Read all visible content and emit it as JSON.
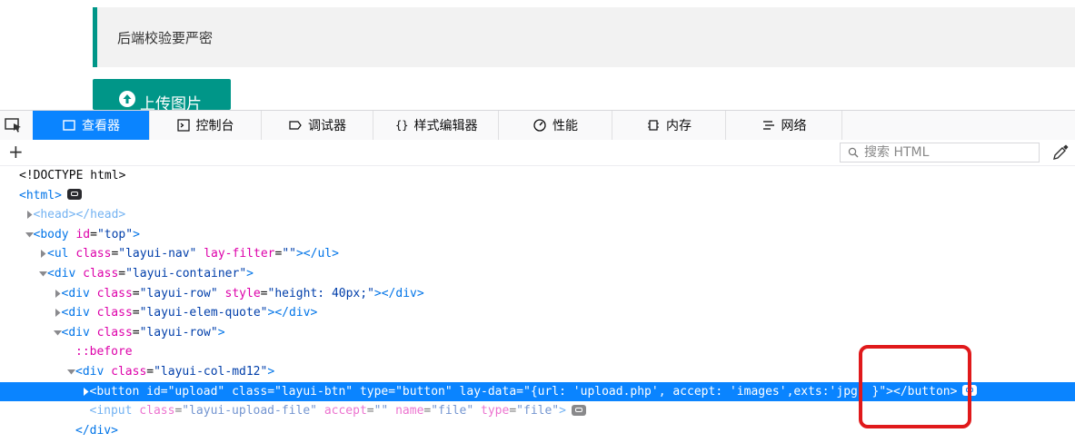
{
  "page": {
    "quote_text": "后端校验要严密",
    "upload_button_label": "上传图片"
  },
  "devtools": {
    "tabs": [
      {
        "label": "查看器",
        "icon": "inspector-icon",
        "active": true
      },
      {
        "label": "控制台",
        "icon": "console-icon",
        "active": false
      },
      {
        "label": "调试器",
        "icon": "debugger-icon",
        "active": false
      },
      {
        "label": "样式编辑器",
        "icon": "style-editor-icon",
        "active": false
      },
      {
        "label": "性能",
        "icon": "performance-icon",
        "active": false
      },
      {
        "label": "内存",
        "icon": "memory-icon",
        "active": false
      },
      {
        "label": "网络",
        "icon": "network-icon",
        "active": false
      }
    ],
    "search_placeholder": "搜索 HTML",
    "accent_color": "#0a84ff"
  },
  "tree": [
    {
      "indent": 0,
      "twisty": "none",
      "selected": false,
      "tokens": [
        [
          "txt",
          "<!DOCTYPE html>"
        ]
      ]
    },
    {
      "indent": 0,
      "twisty": "none",
      "selected": false,
      "badge": true,
      "tokens": [
        [
          "tag",
          "<html>"
        ]
      ]
    },
    {
      "indent": 1,
      "twisty": "closed",
      "selected": false,
      "dim": true,
      "tokens": [
        [
          "tag",
          "<head></head>"
        ]
      ]
    },
    {
      "indent": 1,
      "twisty": "open",
      "selected": false,
      "tokens": [
        [
          "tag",
          "<body"
        ],
        [
          "txt",
          " "
        ],
        [
          "attr",
          "id"
        ],
        [
          "txt",
          "="
        ],
        [
          "val",
          "\"top\""
        ],
        [
          "tag",
          ">"
        ]
      ]
    },
    {
      "indent": 2,
      "twisty": "closed",
      "selected": false,
      "tokens": [
        [
          "tag",
          "<ul"
        ],
        [
          "txt",
          " "
        ],
        [
          "attr",
          "class"
        ],
        [
          "txt",
          "="
        ],
        [
          "val",
          "\"layui-nav\""
        ],
        [
          "txt",
          " "
        ],
        [
          "attr",
          "lay-filter"
        ],
        [
          "txt",
          "="
        ],
        [
          "val",
          "\"\""
        ],
        [
          "tag",
          "></ul>"
        ]
      ]
    },
    {
      "indent": 2,
      "twisty": "open",
      "selected": false,
      "tokens": [
        [
          "tag",
          "<div"
        ],
        [
          "txt",
          " "
        ],
        [
          "attr",
          "class"
        ],
        [
          "txt",
          "="
        ],
        [
          "val",
          "\"layui-container\""
        ],
        [
          "tag",
          ">"
        ]
      ]
    },
    {
      "indent": 3,
      "twisty": "closed",
      "selected": false,
      "tokens": [
        [
          "tag",
          "<div"
        ],
        [
          "txt",
          " "
        ],
        [
          "attr",
          "class"
        ],
        [
          "txt",
          "="
        ],
        [
          "val",
          "\"layui-row\""
        ],
        [
          "txt",
          " "
        ],
        [
          "attr",
          "style"
        ],
        [
          "txt",
          "="
        ],
        [
          "val",
          "\"height: 40px;\""
        ],
        [
          "tag",
          "></div>"
        ]
      ]
    },
    {
      "indent": 3,
      "twisty": "closed",
      "selected": false,
      "tokens": [
        [
          "tag",
          "<div"
        ],
        [
          "txt",
          " "
        ],
        [
          "attr",
          "class"
        ],
        [
          "txt",
          "="
        ],
        [
          "val",
          "\"layui-elem-quote\""
        ],
        [
          "tag",
          "></div>"
        ]
      ]
    },
    {
      "indent": 3,
      "twisty": "open",
      "selected": false,
      "tokens": [
        [
          "tag",
          "<div"
        ],
        [
          "txt",
          " "
        ],
        [
          "attr",
          "class"
        ],
        [
          "txt",
          "="
        ],
        [
          "val",
          "\"layui-row\""
        ],
        [
          "tag",
          ">"
        ]
      ]
    },
    {
      "indent": 4,
      "twisty": "none",
      "selected": false,
      "tokens": [
        [
          "pseudo",
          "::before"
        ]
      ]
    },
    {
      "indent": 4,
      "twisty": "open",
      "selected": false,
      "tokens": [
        [
          "tag",
          "<div"
        ],
        [
          "txt",
          " "
        ],
        [
          "attr",
          "class"
        ],
        [
          "txt",
          "="
        ],
        [
          "val",
          "\"layui-col-md12\""
        ],
        [
          "tag",
          ">"
        ]
      ]
    },
    {
      "indent": 5,
      "twisty": "closed",
      "selected": true,
      "badge": true,
      "tokens": [
        [
          "tag",
          "<button"
        ],
        [
          "txt",
          " "
        ],
        [
          "attr",
          "id"
        ],
        [
          "txt",
          "="
        ],
        [
          "val",
          "\"upload\""
        ],
        [
          "txt",
          " "
        ],
        [
          "attr",
          "class"
        ],
        [
          "txt",
          "="
        ],
        [
          "val",
          "\"layui-btn\""
        ],
        [
          "txt",
          " "
        ],
        [
          "attr",
          "type"
        ],
        [
          "txt",
          "="
        ],
        [
          "val",
          "\"button\""
        ],
        [
          "txt",
          " "
        ],
        [
          "attr",
          "lay-data"
        ],
        [
          "txt",
          "="
        ],
        [
          "val",
          "\"{url: 'upload.php', accept: 'images',exts:'jpg' }\""
        ],
        [
          "tag",
          "></button>"
        ]
      ]
    },
    {
      "indent": 5,
      "twisty": "none",
      "selected": false,
      "dim": true,
      "badge": true,
      "tokens": [
        [
          "tag",
          "<input"
        ],
        [
          "txt",
          " "
        ],
        [
          "attr",
          "class"
        ],
        [
          "txt",
          "="
        ],
        [
          "val",
          "\"layui-upload-file\""
        ],
        [
          "txt",
          " "
        ],
        [
          "attr",
          "accept"
        ],
        [
          "txt",
          "="
        ],
        [
          "val",
          "\"\""
        ],
        [
          "txt",
          " "
        ],
        [
          "attr",
          "name"
        ],
        [
          "txt",
          "="
        ],
        [
          "val",
          "\"file\""
        ],
        [
          "txt",
          " "
        ],
        [
          "attr",
          "type"
        ],
        [
          "txt",
          "="
        ],
        [
          "val",
          "\"file\""
        ],
        [
          "tag",
          ">"
        ]
      ]
    },
    {
      "indent": 4,
      "twisty": "none",
      "selected": false,
      "tokens": [
        [
          "tag",
          "</div>"
        ]
      ]
    }
  ]
}
